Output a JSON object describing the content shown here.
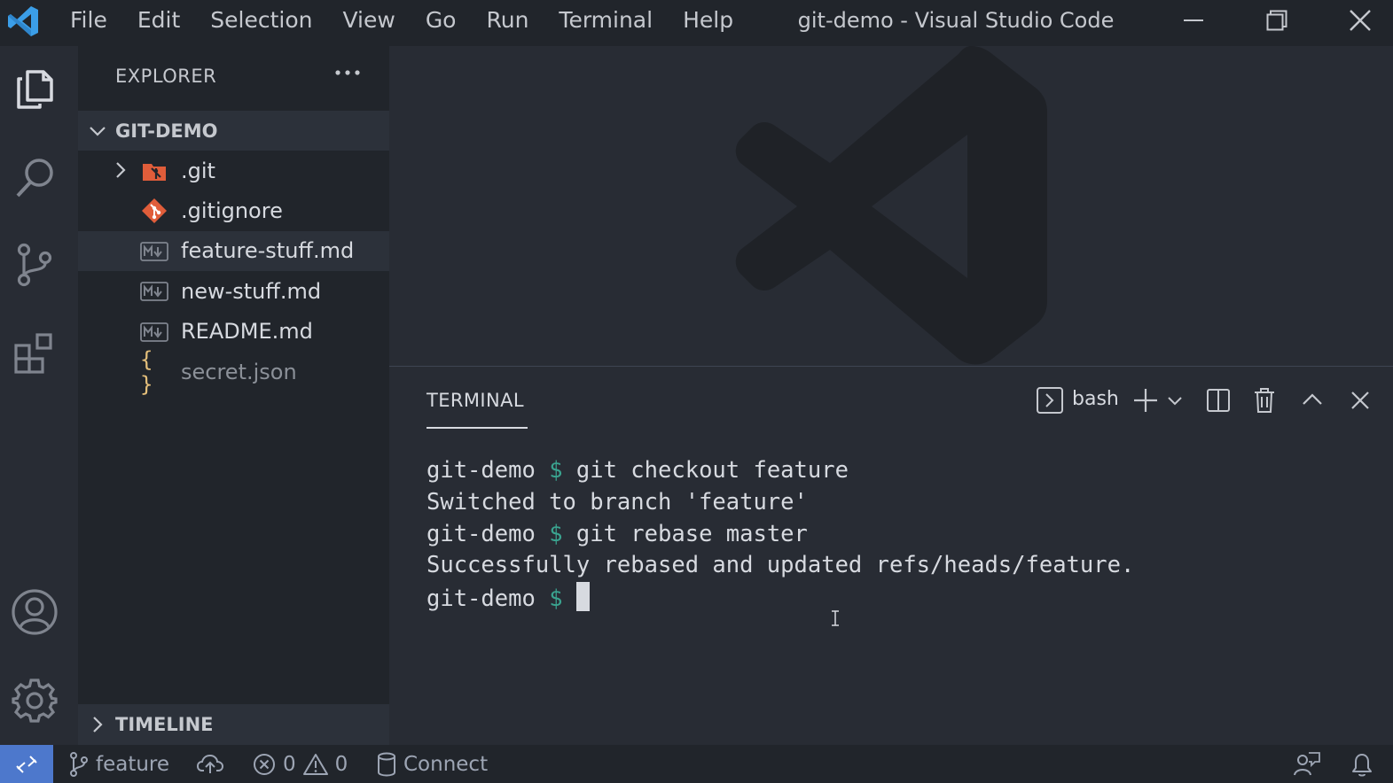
{
  "titlebar": {
    "menu": [
      "File",
      "Edit",
      "Selection",
      "View",
      "Go",
      "Run",
      "Terminal",
      "Help"
    ],
    "title": "git-demo - Visual Studio Code"
  },
  "activitybar": {
    "icons": [
      "explorer-icon",
      "search-icon",
      "source-control-icon",
      "extensions-icon",
      "account-icon",
      "settings-gear-icon"
    ]
  },
  "sidebar": {
    "title": "EXPLORER",
    "folder": "GIT-DEMO",
    "files": [
      {
        "name": ".git",
        "icon": "git-folder-icon",
        "type": "folder"
      },
      {
        "name": ".gitignore",
        "icon": "git-file-icon",
        "type": "file"
      },
      {
        "name": "feature-stuff.md",
        "icon": "markdown-icon",
        "type": "file",
        "selected": true
      },
      {
        "name": "new-stuff.md",
        "icon": "markdown-icon",
        "type": "file"
      },
      {
        "name": "README.md",
        "icon": "markdown-icon",
        "type": "file"
      },
      {
        "name": "secret.json",
        "icon": "json-icon",
        "type": "file",
        "ignored": true
      }
    ],
    "timeline": "TIMELINE"
  },
  "panel": {
    "tab": "TERMINAL",
    "shell": "bash",
    "lines": [
      {
        "prompt": "git-demo",
        "dollar": "$",
        "command": " git checkout feature"
      },
      {
        "output": "Switched to branch 'feature'"
      },
      {
        "prompt": "git-demo",
        "dollar": "$",
        "command": " git rebase master"
      },
      {
        "output": "Successfully rebased and updated refs/heads/feature."
      },
      {
        "prompt": "git-demo",
        "dollar": "$",
        "command": " "
      }
    ]
  },
  "statusbar": {
    "branch": "feature",
    "errors": "0",
    "warnings": "0",
    "connect": "Connect"
  },
  "colors": {
    "accent": "#4d78cc",
    "git_orange": "#e05d3a",
    "json_yellow": "#e5c07b",
    "prompt_green": "#3aa38f"
  }
}
